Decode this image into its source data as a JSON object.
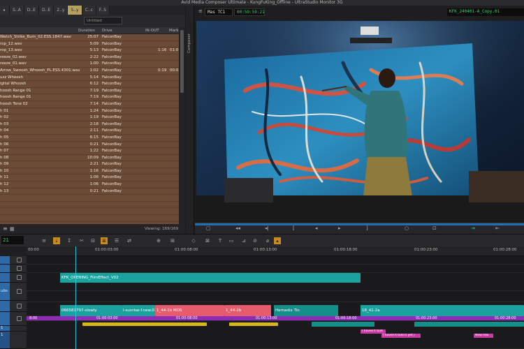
{
  "window": {
    "title": "Avid Media Composer Ultimate - KungFuKing_Offline - UltraStudio Monitor 3G"
  },
  "bin": {
    "tabs": [
      "S..A",
      "D..E",
      "D..E",
      "2..y",
      "S..y",
      "C..c",
      "F..S"
    ],
    "view_dropdown": "Untitled",
    "columns": {
      "name": "",
      "duration": "Duration",
      "drive": "Drive",
      "inout": "IN-OUT",
      "mark": "Mark"
    },
    "rows": [
      {
        "name": "Watch_Strike_Burn_02.ESS.1847.wav",
        "duration": "25:07",
        "drive": "FalconBay",
        "inout": "",
        "mark": ""
      },
      {
        "name": "rop_12.wav",
        "duration": "5:09",
        "drive": "FalconBay",
        "inout": "",
        "mark": ""
      },
      {
        "name": "rop_13.wav",
        "duration": "5:13",
        "drive": "FalconBay",
        "inout": "1:16",
        "mark": "01:0"
      },
      {
        "name": "reeze_02.wav",
        "duration": "2:22",
        "drive": "FalconBay",
        "inout": "",
        "mark": ""
      },
      {
        "name": "reeze_01.wav",
        "duration": "1:00",
        "drive": "FalconBay",
        "inout": "",
        "mark": ""
      },
      {
        "name": "Arrow_Swoosh_Whoosh_PL.ESS.4301.wav",
        "duration": "1:02",
        "drive": "FalconBay",
        "inout": "0:19",
        "mark": "00:0"
      },
      {
        "name": "uzz Whoosh",
        "duration": "5:14",
        "drive": "FalconBay",
        "inout": "",
        "mark": ""
      },
      {
        "name": "igital Whoosh",
        "duration": "6:12",
        "drive": "FalconBay",
        "inout": "",
        "mark": ""
      },
      {
        "name": "hoosh Range 01",
        "duration": "7:19",
        "drive": "FalconBay",
        "inout": "",
        "mark": ""
      },
      {
        "name": "hoosh Range 01",
        "duration": "7:19",
        "drive": "FalconBay",
        "inout": "",
        "mark": ""
      },
      {
        "name": "hoosh Tone 02",
        "duration": "7:14",
        "drive": "FalconBay",
        "inout": "",
        "mark": ""
      },
      {
        "name": "h 01",
        "duration": "1:24",
        "drive": "FalconBay",
        "inout": "",
        "mark": ""
      },
      {
        "name": "h 02",
        "duration": "1:19",
        "drive": "FalconBay",
        "inout": "",
        "mark": ""
      },
      {
        "name": "h 03",
        "duration": "2:18",
        "drive": "FalconBay",
        "inout": "",
        "mark": ""
      },
      {
        "name": "h 04",
        "duration": "2:11",
        "drive": "FalconBay",
        "inout": "",
        "mark": ""
      },
      {
        "name": "h 05",
        "duration": "6:15",
        "drive": "FalconBay",
        "inout": "",
        "mark": ""
      },
      {
        "name": "h 06",
        "duration": "0:21",
        "drive": "FalconBay",
        "inout": "",
        "mark": ""
      },
      {
        "name": "h 07",
        "duration": "1:22",
        "drive": "FalconBay",
        "inout": "",
        "mark": ""
      },
      {
        "name": "h 08",
        "duration": "10:09",
        "drive": "FalconBay",
        "inout": "",
        "mark": ""
      },
      {
        "name": "h 09",
        "duration": "2:21",
        "drive": "FalconBay",
        "inout": "",
        "mark": ""
      },
      {
        "name": "h 10",
        "duration": "1:16",
        "drive": "FalconBay",
        "inout": "",
        "mark": ""
      },
      {
        "name": "h 11",
        "duration": "1:06",
        "drive": "FalconBay",
        "inout": "",
        "mark": ""
      },
      {
        "name": "h 12",
        "duration": "1:06",
        "drive": "FalconBay",
        "inout": "",
        "mark": ""
      },
      {
        "name": "h 13",
        "duration": "0:21",
        "drive": "FalconBay",
        "inout": "",
        "mark": ""
      },
      {
        "name": "",
        "duration": "",
        "drive": "",
        "inout": "",
        "mark": ""
      },
      {
        "name": "",
        "duration": "",
        "drive": "",
        "inout": "",
        "mark": ""
      },
      {
        "name": "",
        "duration": "",
        "drive": "",
        "inout": "",
        "mark": ""
      },
      {
        "name": "",
        "duration": "",
        "drive": "",
        "inout": "",
        "mark": ""
      }
    ],
    "viewing": "Viewing: 169/169"
  },
  "composer": {
    "side_tab": "Composer",
    "tc_label": "Mas TC1",
    "timecode": "00:59:59:21",
    "clip_name": "KFK_240401-A_Copy.01"
  },
  "timeline": {
    "timecode": "21",
    "ruler": [
      "00:00",
      "01:00:03:00",
      "01:00:08:00",
      "01:00:13:00",
      "01:00:18:00",
      "01:00:23:00",
      "01:00:28:00"
    ],
    "track_labels": [
      "ubs",
      "",
      "",
      "1",
      "1"
    ],
    "clips": {
      "v3": "KFK_OPENING_FilmEffect_V02",
      "v1a": "066581797-slowly",
      "v1b": "l-sunrise-f.new.01",
      "v1c": "1_44-1b MOS",
      "v1d": "1_44-2b",
      "v1e": "Hernadix Tin",
      "v1f": "18_41-2a",
      "tc_left": "8:00",
      "tc_a": "01:00:03:00",
      "tc_b": "01:00:08:00",
      "tc_c": "01:00:13:00",
      "tc_d": "01:00:18:00",
      "tc_e": "01:00:23:00",
      "tc_f": "01:00:28:00",
      "a1": "I haven't told",
      "a2": "I haven't told it yet /",
      "a3": "New hex"
    }
  }
}
